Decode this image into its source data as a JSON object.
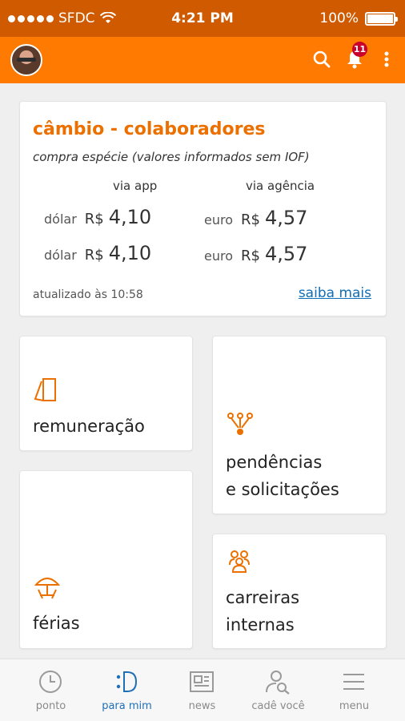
{
  "status_bar": {
    "carrier": "SFDC",
    "time": "4:21 PM",
    "battery": "100%"
  },
  "header": {
    "notification_count": "11"
  },
  "exchange_card": {
    "title": "câmbio - colaboradores",
    "subtitle": "compra espécie (valores informados sem IOF)",
    "col_app": "via app",
    "col_agency": "via agência",
    "rates_app": [
      {
        "currency": "dólar",
        "symbol": "R$",
        "value": "4,10"
      },
      {
        "currency": "dólar",
        "symbol": "R$",
        "value": "4,10"
      }
    ],
    "rates_agency": [
      {
        "currency": "euro",
        "symbol": "R$",
        "value": "4,57"
      },
      {
        "currency": "euro",
        "symbol": "R$",
        "value": "4,57"
      }
    ],
    "updated": "atualizado às 10:58",
    "more_link": "saiba mais"
  },
  "tiles": {
    "remuneracao": "remuneração",
    "pendencias_l1": "pendências",
    "pendencias_l2": "e solicitações",
    "ferias": "férias",
    "carreiras_l1": "carreiras",
    "carreiras_l2": "internas"
  },
  "tabs": [
    {
      "label": "ponto",
      "icon": "clock-icon"
    },
    {
      "label": "para mim",
      "icon": "para-mim-icon"
    },
    {
      "label": "news",
      "icon": "newspaper-icon"
    },
    {
      "label": "cadê você",
      "icon": "person-search-icon"
    },
    {
      "label": "menu",
      "icon": "hamburger-menu-icon"
    }
  ],
  "colors": {
    "brand_orange": "#ff7a00",
    "status_orange": "#cf5a00",
    "accent_text": "#ec7000",
    "link_blue": "#106eb8",
    "badge_red": "#c9002b"
  }
}
